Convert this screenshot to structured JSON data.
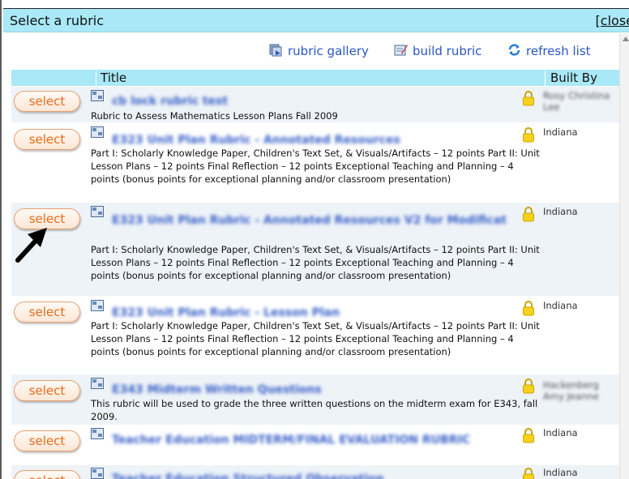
{
  "window": {
    "title": "Select a rubric",
    "close_label": "[close"
  },
  "toolbar": {
    "gallery_label": "rubric gallery",
    "build_label": "build rubric",
    "refresh_label": "refresh list"
  },
  "table": {
    "col_title": "Title",
    "col_built_by": "Built By"
  },
  "colors": {
    "accent": "#a9e8f7",
    "link": "#2a56c6",
    "select_text": "#e86a18"
  },
  "rows": [
    {
      "select": "select",
      "title": "cb lock rubric test",
      "desc": "Rubric to Assess Mathematics Lesson Plans Fall 2009",
      "built_by": "Rosy Christina Lee",
      "built_blur": true
    },
    {
      "select": "select",
      "title": "E323 Unit Plan Rubric - Annotated Resources",
      "desc": "Part I: Scholarly Knowledge Paper, Children's Text Set, & Visuals/Artifacts – 12 points Part II: Unit Lesson Plans – 12 points Final Reflection – 12 points Exceptional Teaching and Planning – 4 points (bonus points for exceptional planning and/or classroom presentation)",
      "built_by": "Indiana",
      "built_blur": false
    },
    {
      "select": "select",
      "title": "E323 Unit Plan Rubric - Annotated Resources V2 for Modificat",
      "desc": "Part I: Scholarly Knowledge Paper, Children's Text Set, & Visuals/Artifacts – 12 points Part II: Unit Lesson Plans – 12 points Final Reflection – 12 points Exceptional Teaching and Planning – 4 points (bonus points for exceptional planning and/or classroom presentation)",
      "built_by": "Indiana",
      "built_blur": false
    },
    {
      "select": "select",
      "title": "E323 Unit Plan Rubric - Lesson Plan",
      "desc": "Part I: Scholarly Knowledge Paper, Children's Text Set, & Visuals/Artifacts – 12 points Part II: Unit Lesson Plans – 12 points Final Reflection – 12 points Exceptional Teaching and Planning – 4 points (bonus points for exceptional planning and/or classroom presentation)",
      "built_by": "Indiana",
      "built_blur": false
    },
    {
      "select": "select",
      "title": "E343 Midterm Written Questions",
      "desc": "This rubric will be used to grade the three written questions on the midterm exam for E343, fall 2009.",
      "built_by": "Hackenberg Amy Jeanne",
      "built_blur": true
    },
    {
      "select": "select",
      "title": "Teacher Education MIDTERM/FINAL EVALUATION RUBRIC",
      "desc": "",
      "built_by": "Indiana",
      "built_blur": false
    },
    {
      "select": "select",
      "title": "Teacher Education Structured Observation",
      "desc": "",
      "built_by": "Indiana",
      "built_blur": false
    }
  ]
}
